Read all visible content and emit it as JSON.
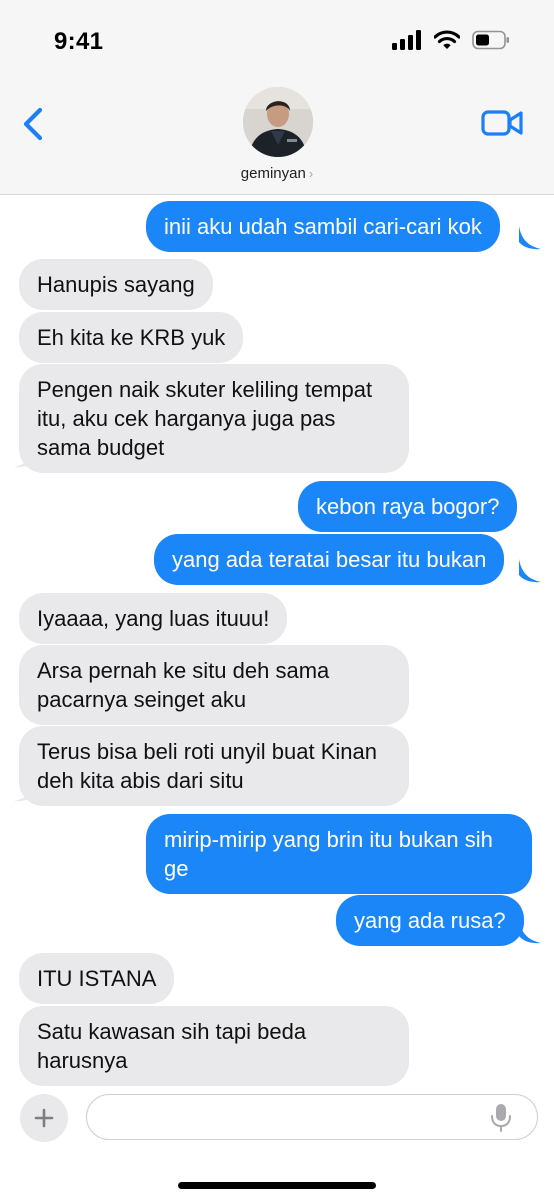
{
  "status_bar": {
    "time": "9:41"
  },
  "header": {
    "contact_name": "geminyan",
    "chevron": "›"
  },
  "messages": [
    {
      "side": "out",
      "text": "inii aku udah sambil cari-cari kok"
    },
    {
      "side": "in",
      "text": "Hanupis sayang"
    },
    {
      "side": "in",
      "text": "Eh kita ke KRB yuk"
    },
    {
      "side": "in",
      "text": "Pengen naik skuter keliling tempat itu, aku cek harganya juga pas sama budget"
    },
    {
      "side": "out",
      "text": "kebon raya bogor?"
    },
    {
      "side": "out",
      "text": "yang ada teratai besar itu bukan"
    },
    {
      "side": "in",
      "text": "Iyaaaa, yang luas ituuu!"
    },
    {
      "side": "in",
      "text": "Arsa pernah ke situ deh sama pacarnya seinget aku"
    },
    {
      "side": "in",
      "text": "Terus bisa beli roti unyil buat Kinan deh kita abis dari situ"
    },
    {
      "side": "out",
      "text": "mirip-mirip yang brin itu bukan sih ge"
    },
    {
      "side": "out",
      "text": "yang ada rusa?"
    },
    {
      "side": "in",
      "text": "ITU ISTANA"
    },
    {
      "side": "in",
      "text": "Satu kawasan sih tapi beda harusnya"
    }
  ],
  "composer": {
    "plus": "+",
    "input_value": "",
    "input_placeholder": ""
  },
  "colors": {
    "outgoing": "#1b86f7",
    "incoming": "#e9e9eb",
    "accent": "#1b7ff5"
  },
  "icons": [
    "cellular-signal-icon",
    "wifi-icon",
    "battery-icon",
    "back-chevron-icon",
    "facetime-video-icon",
    "plus-icon",
    "microphone-icon"
  ]
}
